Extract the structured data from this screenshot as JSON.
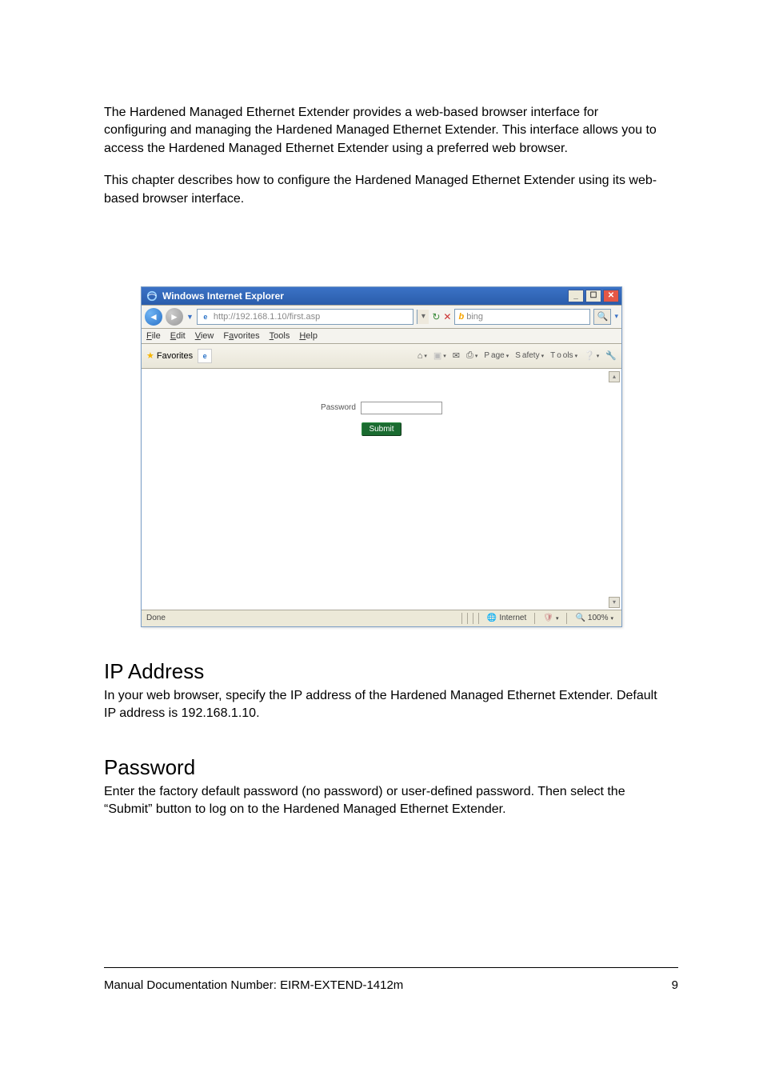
{
  "intro_para1": "The Hardened Managed Ethernet Extender provides a web-based browser interface for configuring and managing the Hardened Managed Ethernet Extender. This interface allows you to access the Hardened Managed Ethernet Extender using a preferred web browser.",
  "intro_para2": "This chapter describes how to configure the Hardened Managed Ethernet Extender using its web-based browser interface.",
  "ie": {
    "title": "Windows Internet Explorer",
    "url": "http://192.168.1.10/first.asp",
    "search_placeholder": "bing",
    "menus": [
      "File",
      "Edit",
      "View",
      "Favorites",
      "Tools",
      "Help"
    ],
    "favorites": "Favorites",
    "toolbar": {
      "page": "Page",
      "safety": "Safety",
      "tools": "Tools"
    },
    "form": {
      "password_label": "Password",
      "submit": "Submit"
    },
    "status": {
      "left": "Done",
      "zone": "Internet",
      "zoom": "100%"
    }
  },
  "ip": {
    "heading": "IP Address",
    "text": "In your web browser, specify the IP address of the Hardened Managed Ethernet Extender. Default IP address is 192.168.1.10."
  },
  "password": {
    "heading": "Password",
    "text": "Enter the factory default password (no password) or user-defined password. Then select the “Submit” button to log on to the Hardened Managed Ethernet Extender."
  },
  "footer": {
    "left": "Manual Documentation Number: EIRM-EXTEND-1412m",
    "right": "9"
  }
}
